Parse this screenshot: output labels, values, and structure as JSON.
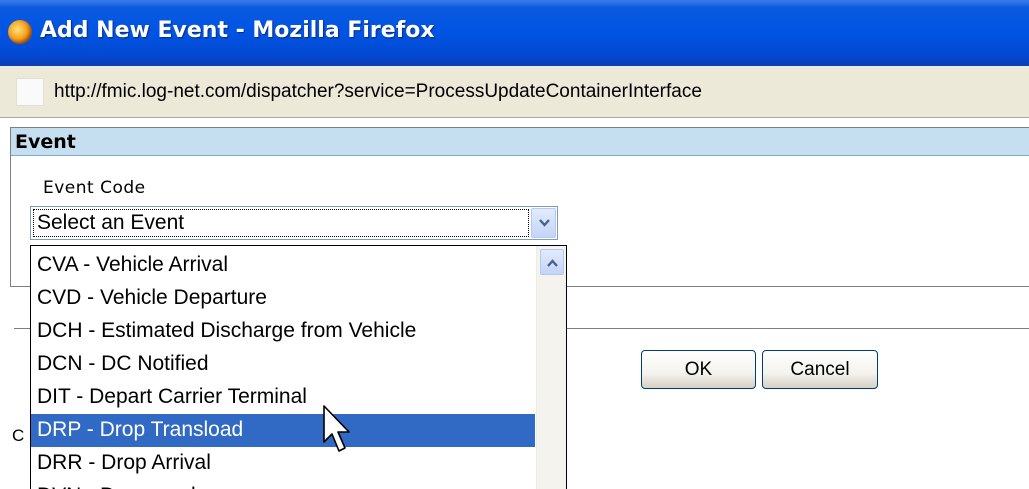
{
  "window": {
    "title": "Add New Event - Mozilla Firefox",
    "icon": "firefox-icon",
    "title_bar_color": "#0054e3"
  },
  "address_bar": {
    "url": "http://fmic.log-net.com/dispatcher?service=ProcessUpdateContainerInterface"
  },
  "event_panel": {
    "header": "Event",
    "header_color": "#c6dff0",
    "event_code_label": "Event Code",
    "event_code_select": {
      "selected_value": "Select an Event",
      "options": [
        "CVA - Vehicle Arrival",
        "CVD - Vehicle Departure",
        "DCH - Estimated Discharge from Vehicle",
        "DCN - DC Notified",
        "DIT - Depart Carrier Terminal",
        "DRP - Drop Transload",
        "DRR - Drop Arrival",
        "DVN - Devanned"
      ],
      "highlighted_option": "DRP - Drop Transload",
      "highlight_color": "#316ac5"
    }
  },
  "buttons": {
    "ok_label": "OK",
    "cancel_label": "Cancel"
  },
  "partial_text": {
    "left_label": "C"
  },
  "icons": {
    "dropdown_arrow": "chevron-down-icon",
    "scroll_up": "chevron-up-icon",
    "cursor": "mouse-pointer-icon"
  }
}
